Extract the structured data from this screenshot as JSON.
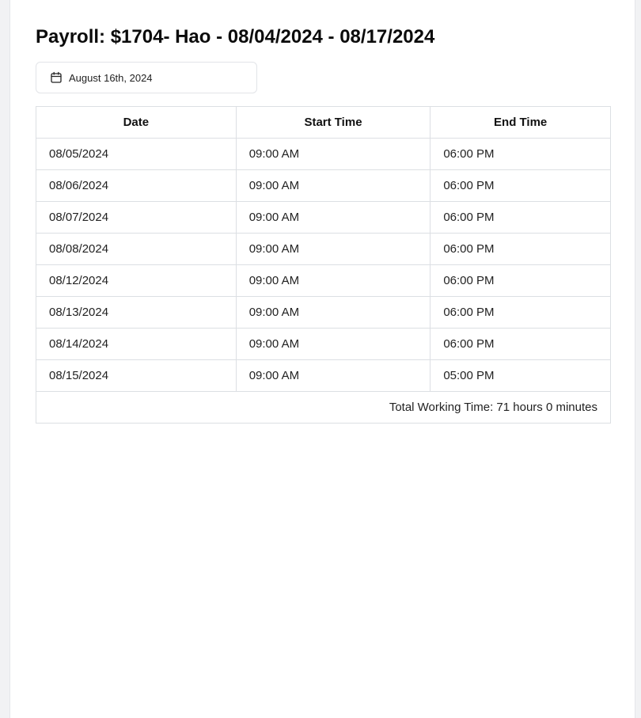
{
  "page_title": "Payroll: $1704- Hao - 08/04/2024 - 08/17/2024",
  "date_picker": {
    "icon": "calendar-icon",
    "value": "August 16th, 2024"
  },
  "table": {
    "headers": [
      "Date",
      "Start Time",
      "End Time"
    ],
    "rows": [
      {
        "date": "08/05/2024",
        "start": "09:00 AM",
        "end": "06:00 PM"
      },
      {
        "date": "08/06/2024",
        "start": "09:00 AM",
        "end": "06:00 PM"
      },
      {
        "date": "08/07/2024",
        "start": "09:00 AM",
        "end": "06:00 PM"
      },
      {
        "date": "08/08/2024",
        "start": "09:00 AM",
        "end": "06:00 PM"
      },
      {
        "date": "08/12/2024",
        "start": "09:00 AM",
        "end": "06:00 PM"
      },
      {
        "date": "08/13/2024",
        "start": "09:00 AM",
        "end": "06:00 PM"
      },
      {
        "date": "08/14/2024",
        "start": "09:00 AM",
        "end": "06:00 PM"
      },
      {
        "date": "08/15/2024",
        "start": "09:00 AM",
        "end": "05:00 PM"
      }
    ],
    "total": "Total Working Time: 71 hours 0 minutes"
  }
}
